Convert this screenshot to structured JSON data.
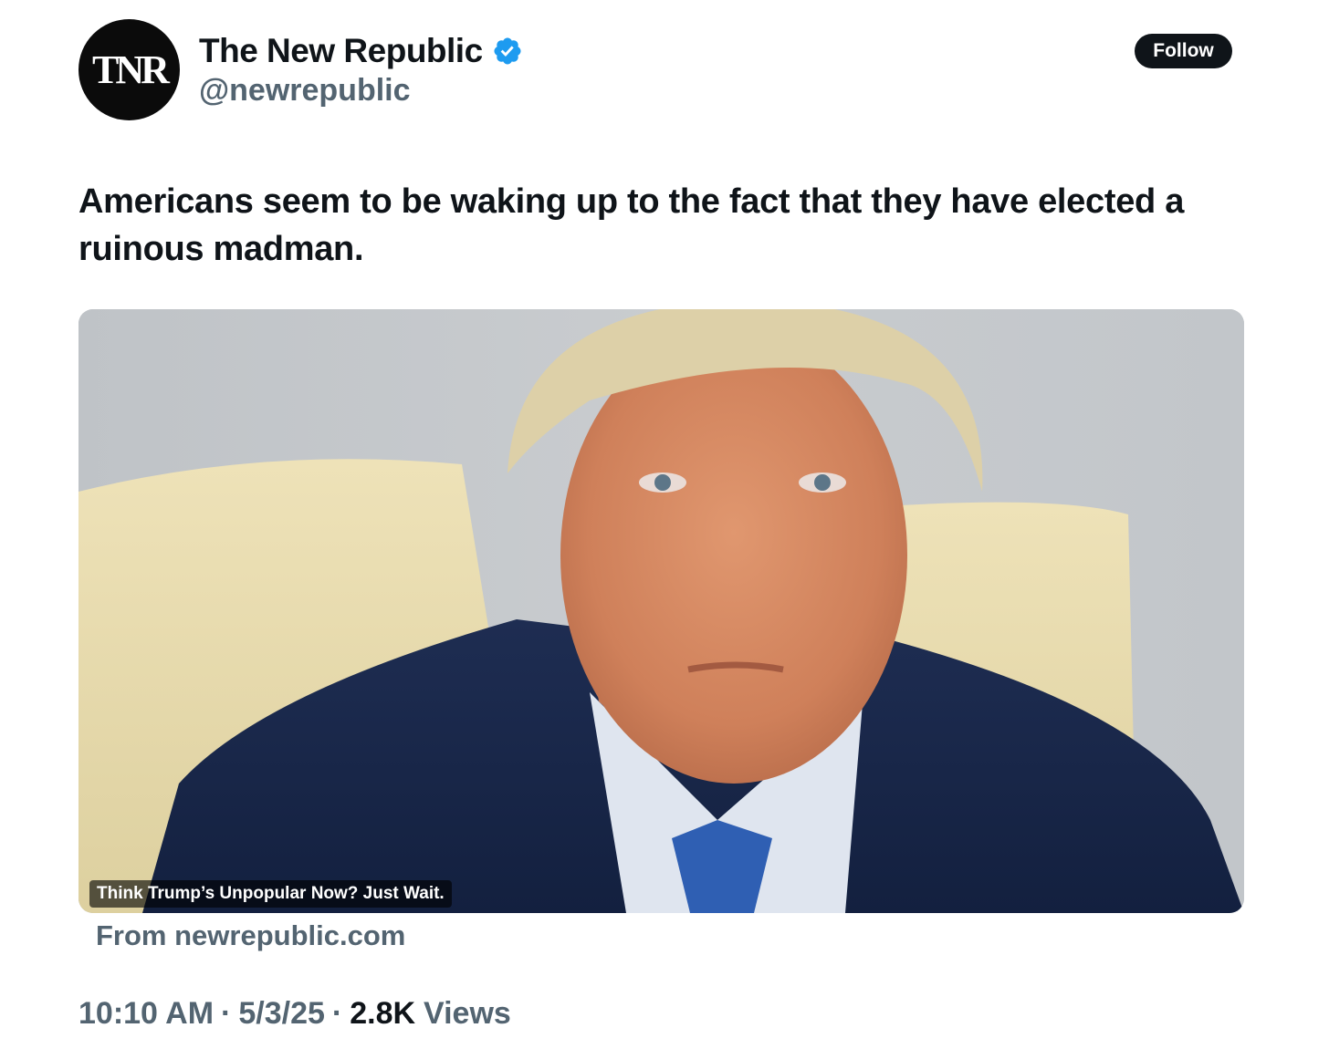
{
  "author": {
    "avatar_text": "TNR",
    "display_name": "The New Republic",
    "handle": "@newrepublic",
    "verified": true
  },
  "follow_label": "Follow",
  "tweet": {
    "text": "Americans seem to be waking up to the fact that they have elected a ruinous madman."
  },
  "card": {
    "title": "Think Trump’s Unpopular Now? Just Wait.",
    "source": "From newrepublic.com"
  },
  "meta": {
    "time": "10:10 AM",
    "separator": "·",
    "date": "5/3/25",
    "views_count": "2.8K",
    "views_label": "Views"
  },
  "colors": {
    "text_primary": "#0f1419",
    "text_secondary": "#536471",
    "verified_blue": "#1d9bf0",
    "follow_bg": "#0f1419"
  }
}
